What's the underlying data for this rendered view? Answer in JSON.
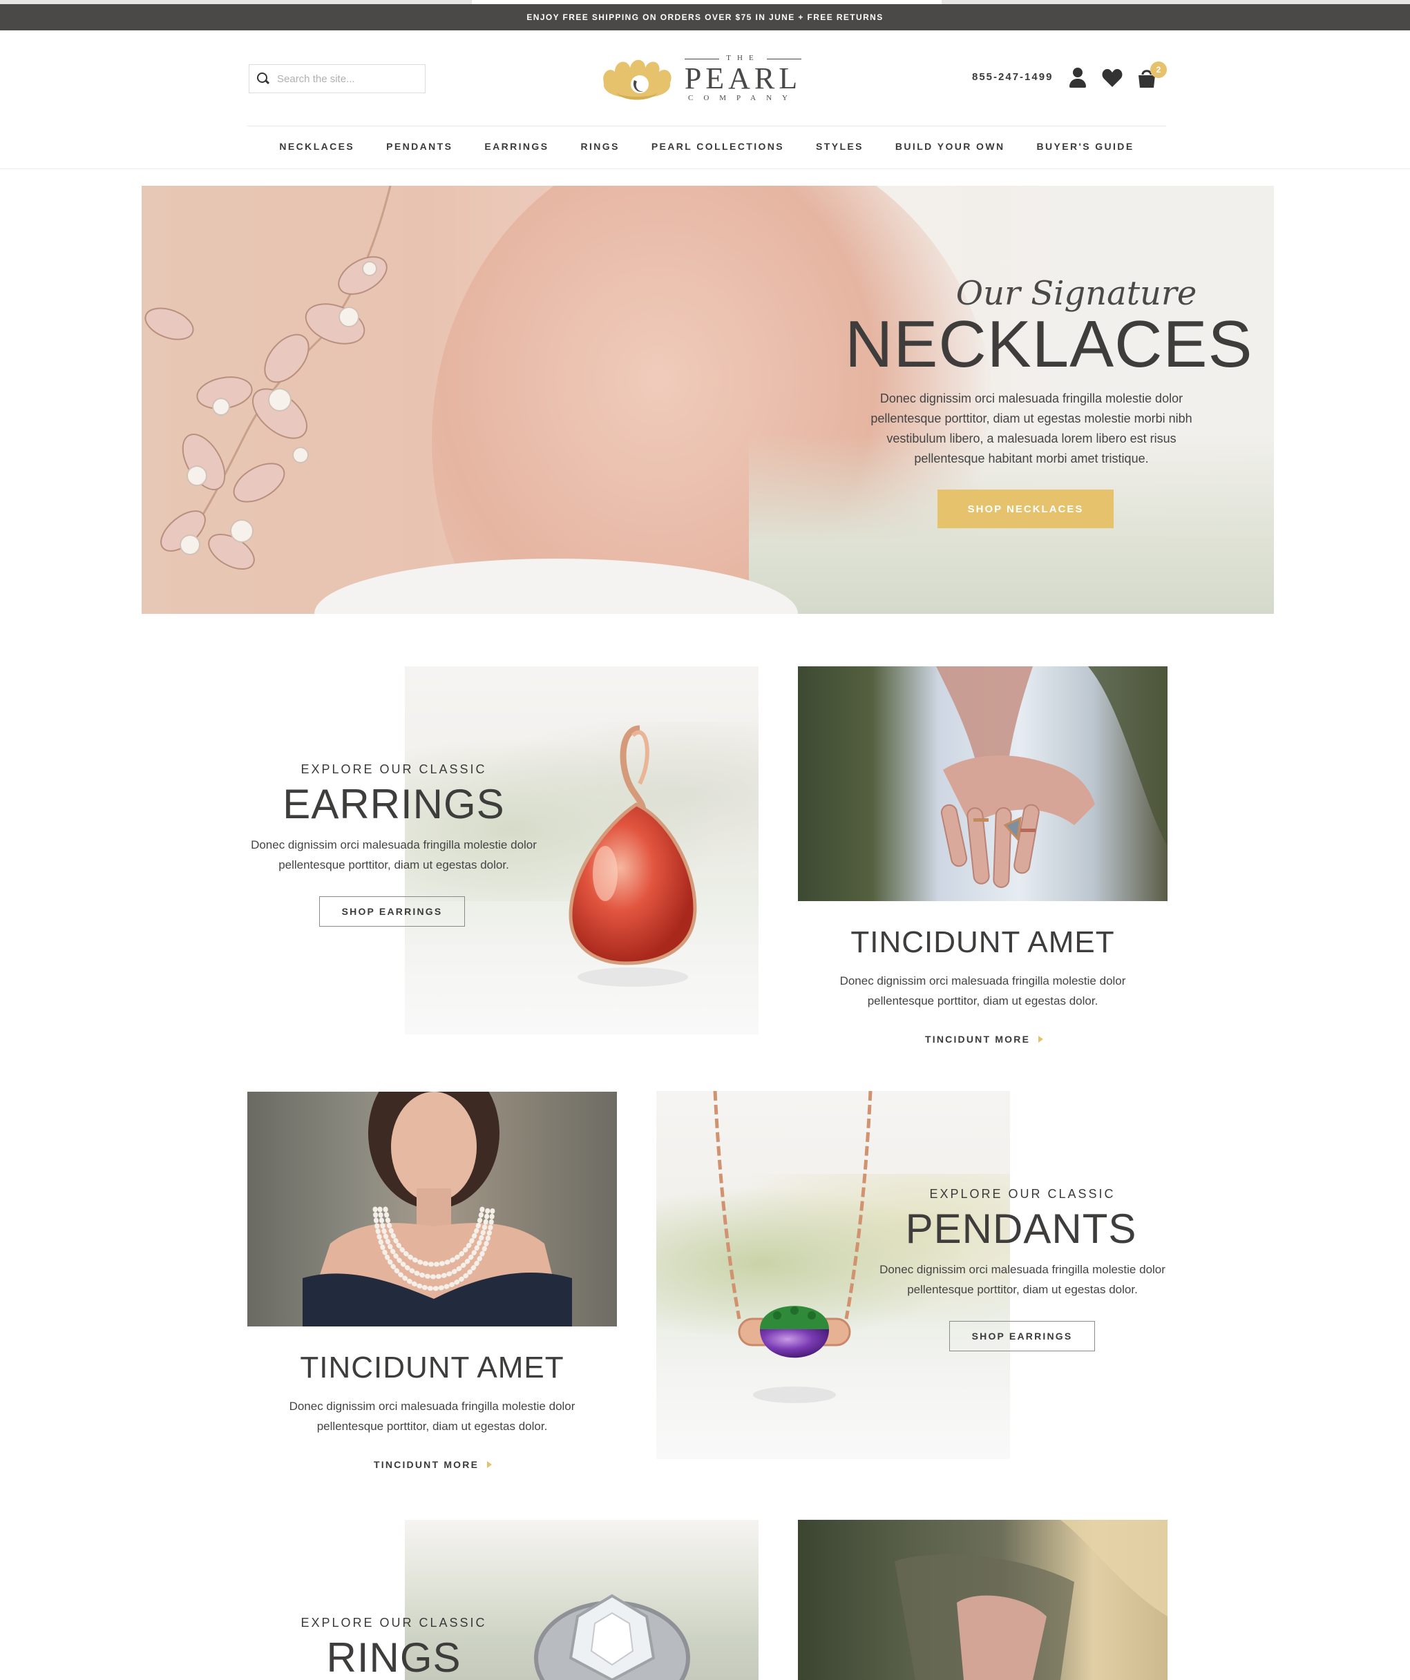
{
  "promo": {
    "text": "ENJOY FREE SHIPPING ON ORDERS OVER $75 IN JUNE + FREE RETURNS"
  },
  "header": {
    "search_placeholder": "Search the site...",
    "brand": {
      "the": "THE",
      "name": "PEARL",
      "company": "COMPANY"
    },
    "phone": "855-247-1499",
    "cart_count": "2"
  },
  "nav": {
    "items": [
      {
        "label": "NECKLACES"
      },
      {
        "label": "PENDANTS"
      },
      {
        "label": "EARRINGS"
      },
      {
        "label": "RINGS"
      },
      {
        "label": "PEARL COLLECTIONS"
      },
      {
        "label": "STYLES"
      },
      {
        "label": "BUILD YOUR OWN"
      },
      {
        "label": "BUYER'S GUIDE"
      }
    ]
  },
  "hero": {
    "script": "Our Signature",
    "title": "NECKLACES",
    "description": "Donec dignissim orci malesuada fringilla molestie dolor pellentesque porttitor, diam ut egestas molestie morbi nibh vestibulum libero, a malesuada lorem libero est risus pellentesque habitant morbi amet tristique.",
    "cta": "SHOP NECKLACES"
  },
  "earrings": {
    "kicker": "EXPLORE OUR CLASSIC",
    "title": "EARRINGS",
    "description": "Donec dignissim orci malesuada fringilla molestie dolor pellentesque porttitor, diam ut egestas dolor.",
    "cta": "SHOP EARRINGS"
  },
  "card1": {
    "title": "TINCIDUNT AMET",
    "description": "Donec dignissim orci malesuada fringilla molestie dolor pellentesque porttitor, diam ut egestas dolor.",
    "more": "TINCIDUNT MORE"
  },
  "card2": {
    "title": "TINCIDUNT AMET",
    "description": "Donec dignissim orci malesuada fringilla molestie dolor pellentesque porttitor, diam ut egestas dolor.",
    "more": "TINCIDUNT MORE"
  },
  "pendants": {
    "kicker": "EXPLORE OUR CLASSIC",
    "title": "PENDANTS",
    "description": "Donec dignissim orci malesuada fringilla molestie dolor pellentesque porttitor, diam ut egestas dolor.",
    "cta": "SHOP EARRINGS"
  },
  "rings": {
    "kicker": "EXPLORE OUR CLASSIC",
    "title": "RINGS"
  },
  "icons": {
    "search": "search-icon",
    "logo": "pearl-shell-logo",
    "user": "user-icon",
    "wishlist": "heart-icon",
    "cart": "shopping-bag-icon",
    "more_arrow": "arrow-right-icon"
  },
  "colors": {
    "accent": "#e5c26b",
    "promo_bar": "#4a4948",
    "text": "#3a3a3a"
  }
}
